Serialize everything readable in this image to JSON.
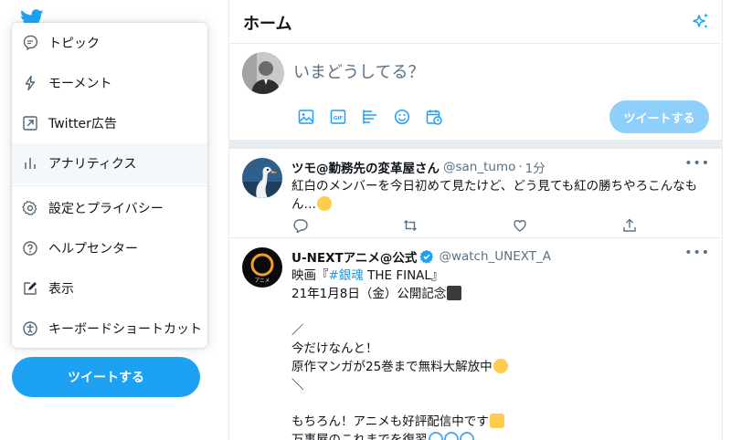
{
  "menu": {
    "items": [
      {
        "label": "トピック",
        "icon": "topic-icon"
      },
      {
        "label": "モーメント",
        "icon": "lightning-icon"
      },
      {
        "label": "Twitter広告",
        "icon": "external-arrow-icon"
      },
      {
        "label": "アナリティクス",
        "icon": "bar-chart-icon"
      },
      {
        "label": "設定とプライバシー",
        "icon": "gear-icon"
      },
      {
        "label": "ヘルプセンター",
        "icon": "help-icon"
      },
      {
        "label": "表示",
        "icon": "display-icon"
      },
      {
        "label": "キーボードショートカット",
        "icon": "accessibility-icon"
      }
    ]
  },
  "sidebar": {
    "tweet_button": "ツイートする"
  },
  "header": {
    "title": "ホーム"
  },
  "compose": {
    "placeholder": "いまどうしてる？",
    "submit_label": "ツイートする"
  },
  "tweets": [
    {
      "name": "ツモ@勤務先の変革屋さん",
      "handle": "@san_tumo",
      "sep": "·",
      "time": "1分",
      "line1": "紅白のメンバーを今日初めて見たけど、どう見ても紅の勝ちやろこんなも",
      "line2": "ん…"
    },
    {
      "name": "U-NEXTアニメ@公式",
      "handle": "@watch_UNEXT_A",
      "avatar_text": "アニメ",
      "body": {
        "l1_pre": "映画『",
        "l1_tag": "#銀魂",
        "l1_post": " THE FINAL』",
        "l2": "21年1月8日（金）公開記念",
        "l3": "／",
        "l4": "今だけなんと！",
        "l5": "原作マンガが25巻まで無料大解放中",
        "l6": "＼",
        "l7": "もちろん！アニメも好評配信中です",
        "l8": "万事屋のこれまでを復習"
      }
    }
  ],
  "colors": {
    "accent": "#1da1f2",
    "accent_light": "#8ed0f9",
    "divider": "#e6ecf0",
    "secondary_text": "#5b7083"
  }
}
